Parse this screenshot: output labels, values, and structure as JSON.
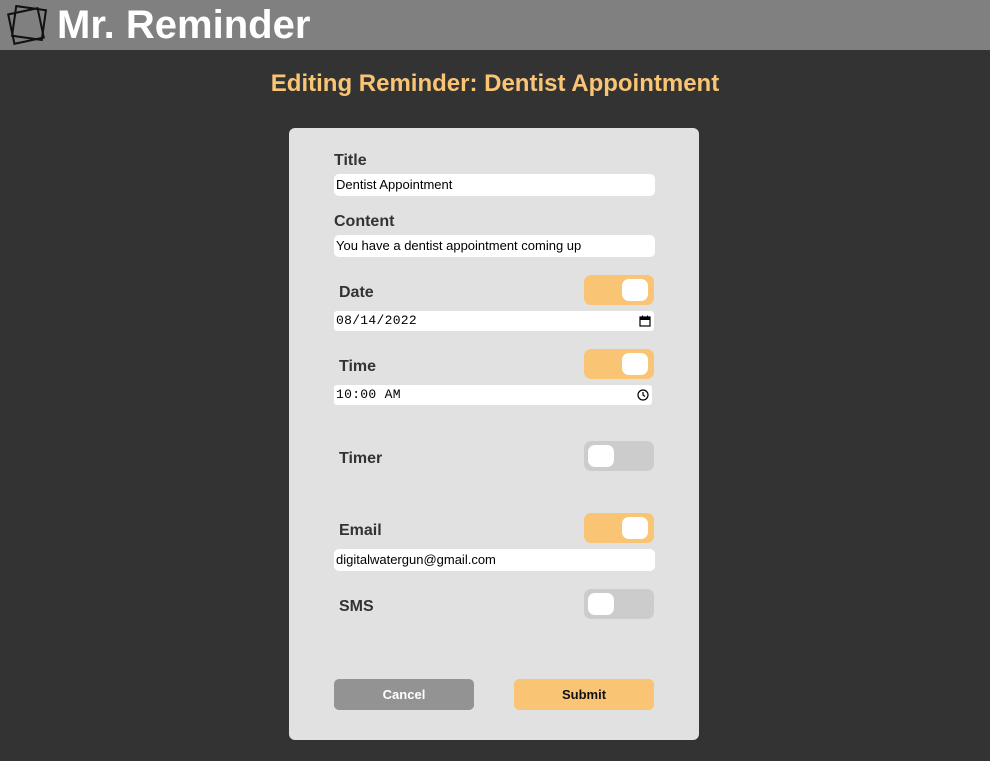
{
  "app": {
    "title": "Mr. Reminder"
  },
  "page": {
    "heading": "Editing Reminder: Dentist Appointment"
  },
  "form": {
    "title_label": "Title",
    "title_value": "Dentist Appointment",
    "content_label": "Content",
    "content_value": "You have a dentist appointment coming up",
    "date_label": "Date",
    "date_enabled": true,
    "date_value": "08/14/2022",
    "time_label": "Time",
    "time_enabled": true,
    "time_value": "10:00 AM",
    "timer_label": "Timer",
    "timer_enabled": false,
    "email_label": "Email",
    "email_enabled": true,
    "email_value": "digitalwatergun@gmail.com",
    "sms_label": "SMS",
    "sms_enabled": false,
    "cancel_label": "Cancel",
    "submit_label": "Submit"
  },
  "colors": {
    "accent": "#f9c574",
    "background": "#333333",
    "topbar": "#808080",
    "card": "#e1e1e1",
    "toggle_off": "#cccccc",
    "cancel_button": "#939393"
  },
  "icons": {
    "logo": "stacked-notes-logo-icon",
    "date_picker": "calendar-icon",
    "time_picker": "clock-icon"
  }
}
